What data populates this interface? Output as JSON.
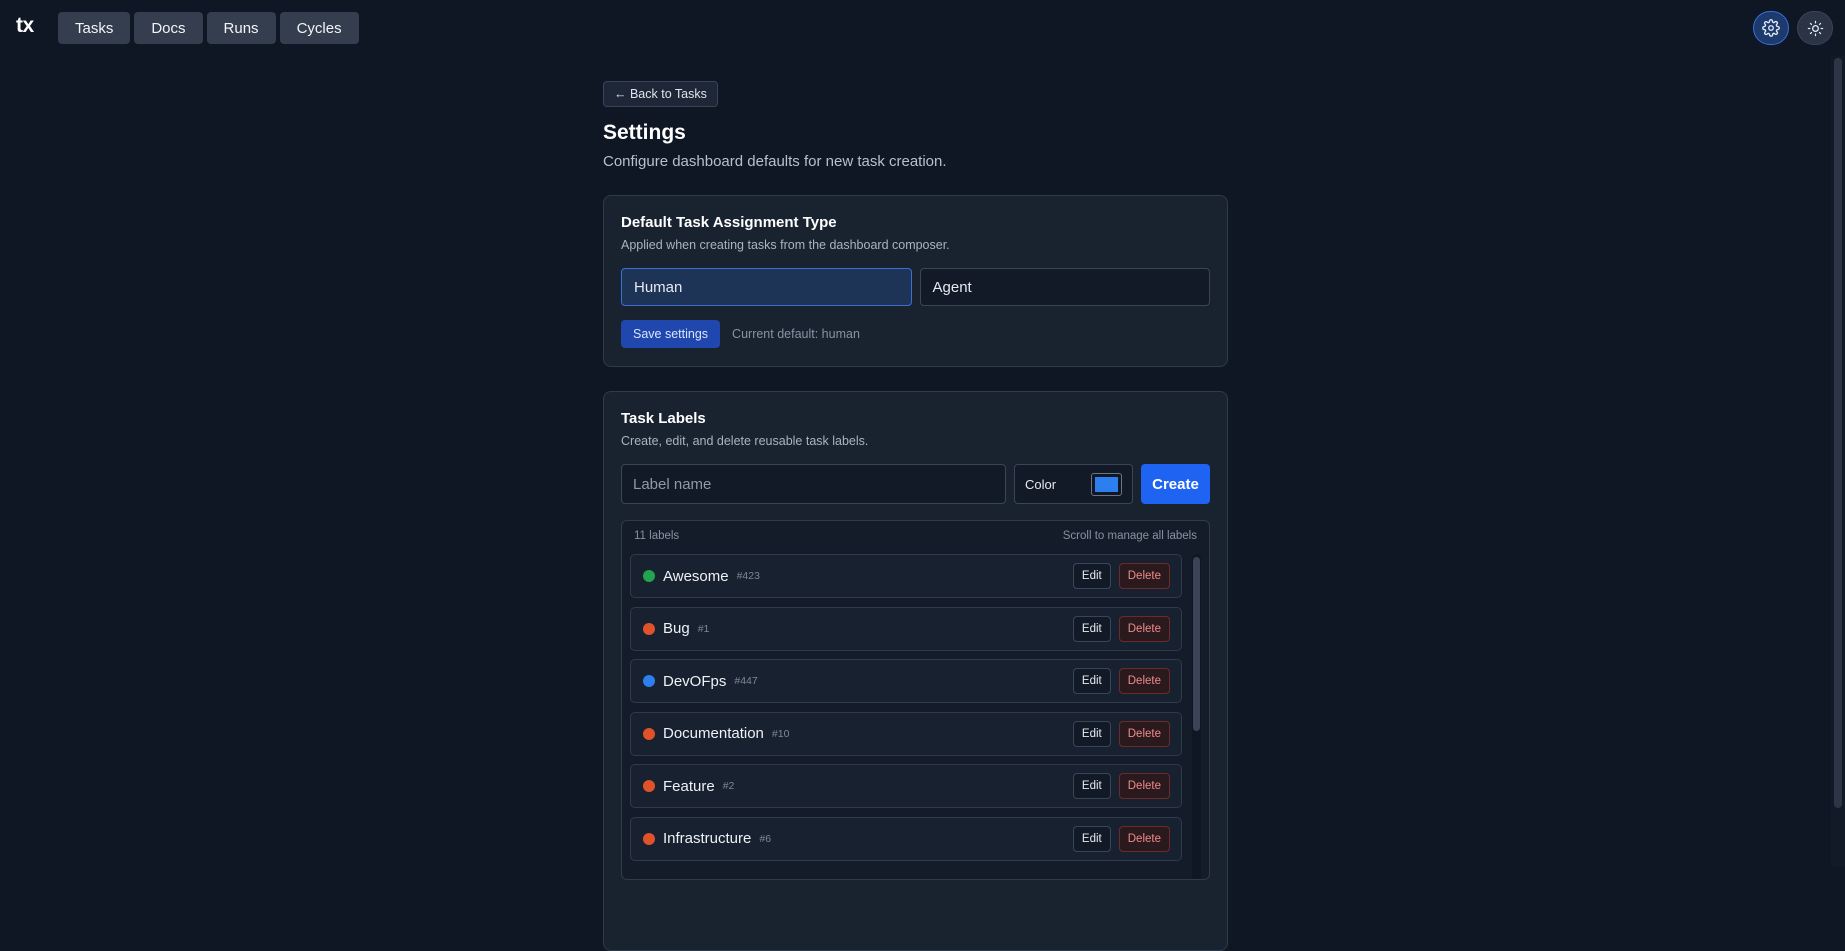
{
  "app": {
    "logo": "tx",
    "nav": [
      {
        "label": "Tasks"
      },
      {
        "label": "Docs"
      },
      {
        "label": "Runs"
      },
      {
        "label": "Cycles"
      }
    ],
    "icons": [
      "gear-icon",
      "sun-icon"
    ]
  },
  "page": {
    "back_label": "← Back to Tasks",
    "title": "Settings",
    "subtitle": "Configure dashboard defaults for new task creation."
  },
  "assignment": {
    "heading": "Default Task Assignment Type",
    "description": "Applied when creating tasks from the dashboard composer.",
    "options": [
      {
        "label": "Human",
        "selected": true
      },
      {
        "label": "Agent",
        "selected": false
      }
    ],
    "save_label": "Save settings",
    "current_note": "Current default: human"
  },
  "labels": {
    "heading": "Task Labels",
    "description": "Create, edit, and delete reusable task labels.",
    "name_placeholder": "Label name",
    "color_label": "Color",
    "color_value": "#2d7ff0",
    "create_label": "Create",
    "count_text": "11 labels",
    "scroll_hint": "Scroll to manage all labels",
    "edit_label": "Edit",
    "delete_label": "Delete",
    "items": [
      {
        "name": "Awesome",
        "id": "#423",
        "color": "#22a34f"
      },
      {
        "name": "Bug",
        "id": "#1",
        "color": "#e0522a"
      },
      {
        "name": "DevOFps",
        "id": "#447",
        "color": "#2d7ff0"
      },
      {
        "name": "Documentation",
        "id": "#10",
        "color": "#e0522a"
      },
      {
        "name": "Feature",
        "id": "#2",
        "color": "#e0522a"
      },
      {
        "name": "Infrastructure",
        "id": "#6",
        "color": "#e0522a"
      }
    ]
  }
}
